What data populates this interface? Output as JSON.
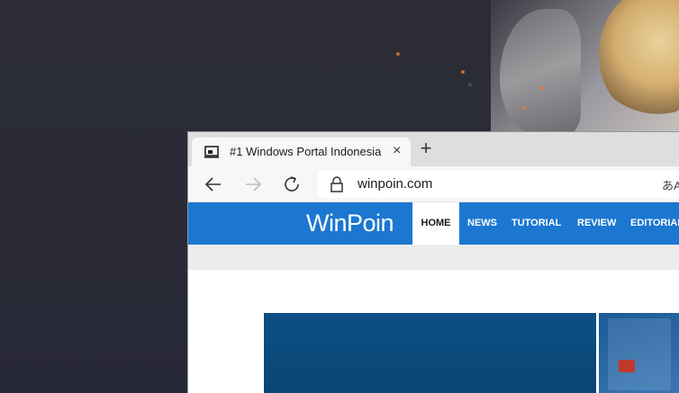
{
  "browser": {
    "tab": {
      "title": "#1 Windows Portal Indonesia",
      "close_glyph": "×",
      "favicon": "laptop-icon"
    },
    "new_tab_glyph": "+",
    "address": {
      "url": "winpoin.com",
      "read_aloud_glyph": "あA"
    },
    "icons": {
      "back": "back-arrow-icon",
      "forward": "forward-arrow-icon",
      "refresh": "refresh-icon",
      "lock": "lock-icon"
    }
  },
  "site": {
    "logo": "WinPoin",
    "nav": [
      {
        "label": "HOME",
        "active": true
      },
      {
        "label": "NEWS",
        "active": false
      },
      {
        "label": "TUTORIAL",
        "active": false
      },
      {
        "label": "REVIEW",
        "active": false
      },
      {
        "label": "EDITORIAL",
        "active": false
      }
    ]
  },
  "colors": {
    "accent": "#1b77d0",
    "desktop": "#2a2b36",
    "hero": "#0d4f84"
  }
}
